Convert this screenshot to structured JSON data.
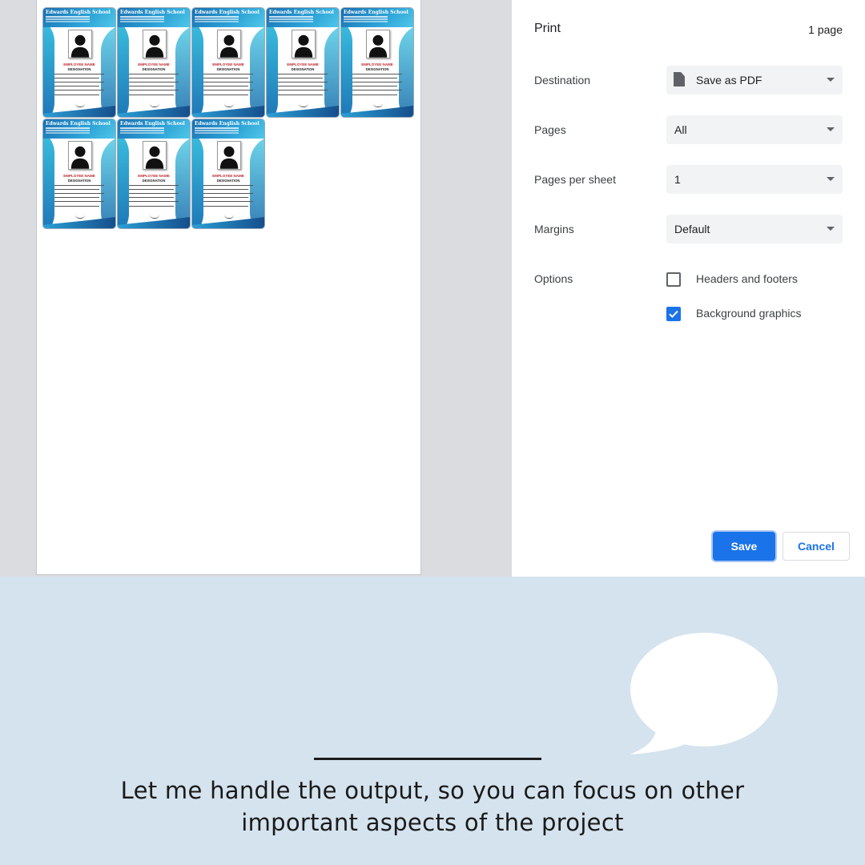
{
  "settings": {
    "title": "Print",
    "page_count": "1 page",
    "destination": {
      "label": "Destination",
      "value": "Save as PDF",
      "icon": "file-icon"
    },
    "pages": {
      "label": "Pages",
      "value": "All"
    },
    "pages_per_sheet": {
      "label": "Pages per sheet",
      "value": "1"
    },
    "margins": {
      "label": "Margins",
      "value": "Default"
    },
    "options": {
      "label": "Options",
      "headers_footers": {
        "label": "Headers and footers",
        "checked": false
      },
      "background_graphics": {
        "label": "Background graphics",
        "checked": true
      }
    },
    "save_label": "Save",
    "cancel_label": "Cancel",
    "accent_color": "#1a73e8"
  },
  "preview": {
    "card_count": 8,
    "cards": [
      {
        "school": "Edwards English School",
        "name": "EMPLOYEE NAME",
        "designation": "DESIGNATION"
      },
      {
        "school": "Edwards English School",
        "name": "EMPLOYEE NAME",
        "designation": "DESIGNATION"
      },
      {
        "school": "Edwards English School",
        "name": "EMPLOYEE NAME",
        "designation": "DESIGNATION"
      },
      {
        "school": "Edwards English School",
        "name": "EMPLOYEE NAME",
        "designation": "DESIGNATION"
      },
      {
        "school": "Edwards English School",
        "name": "EMPLOYEE NAME",
        "designation": "DESIGNATION"
      },
      {
        "school": "Edwards English School",
        "name": "EMPLOYEE NAME",
        "designation": "DESIGNATION"
      },
      {
        "school": "Edwards English School",
        "name": "EMPLOYEE NAME",
        "designation": "DESIGNATION"
      },
      {
        "school": "Edwards English School",
        "name": "EMPLOYEE NAME",
        "designation": "DESIGNATION"
      }
    ]
  },
  "banner": {
    "tagline_line1": "Let me handle the output, so you can focus on other",
    "tagline_line2": "important aspects of the project",
    "background_color": "#d5e3ee"
  }
}
